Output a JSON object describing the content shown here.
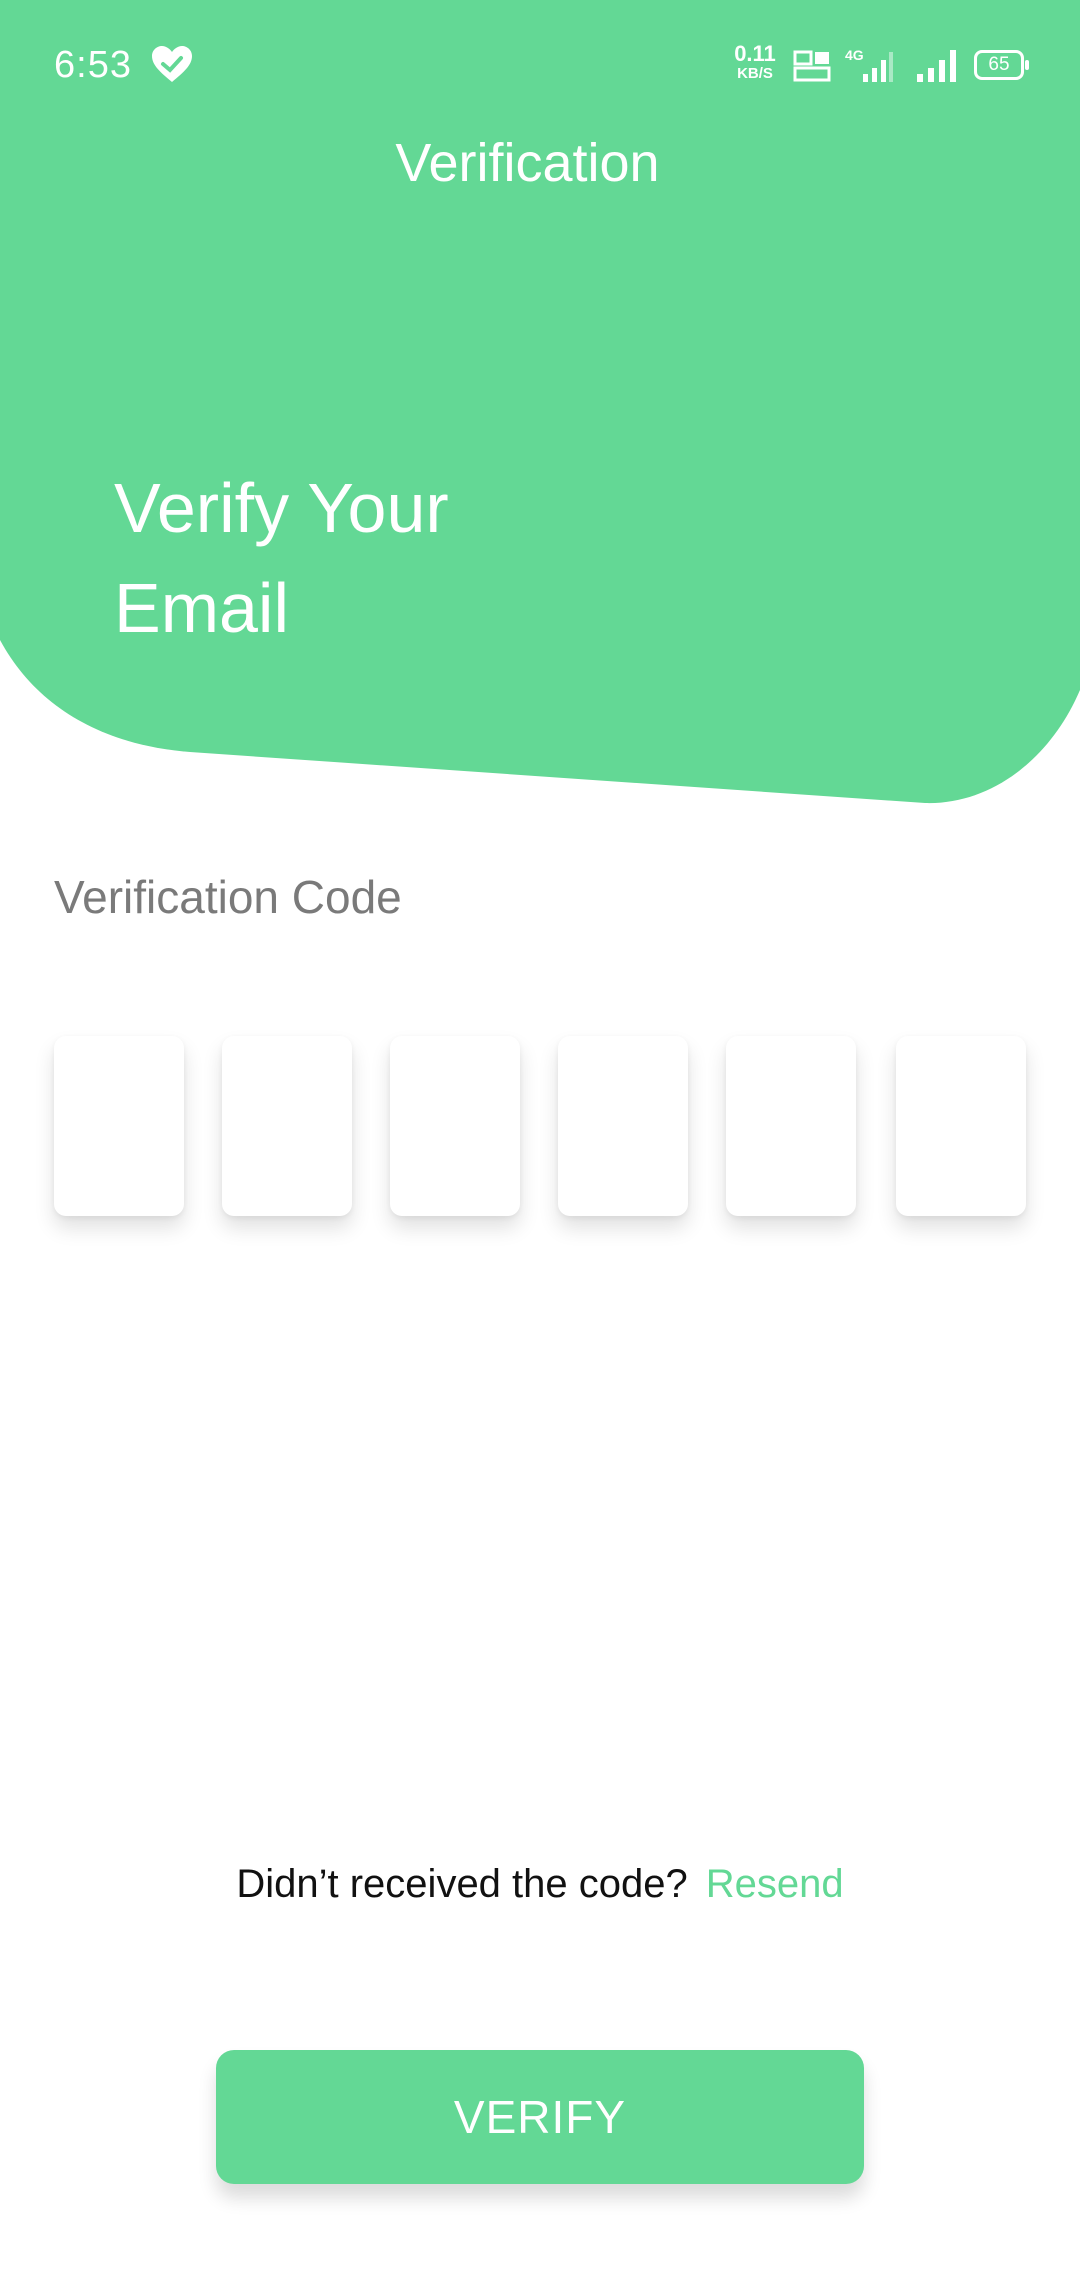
{
  "colors": {
    "accent": "#63d895",
    "background": "#ffffff",
    "label_gray": "#7a7a7a"
  },
  "status_bar": {
    "time": "6:53",
    "net_speed": "0.11",
    "net_unit": "KB/S",
    "network_type": "4G",
    "battery_level": "65"
  },
  "header": {
    "title": "Verification",
    "headline_line1": "Verify Your",
    "headline_line2": "Email"
  },
  "form": {
    "code_label": "Verification Code",
    "code_digits": [
      "",
      "",
      "",
      "",
      "",
      ""
    ]
  },
  "footer": {
    "prompt": "Didn’t received the code?",
    "resend_label": "Resend",
    "verify_label": "VERIFY"
  },
  "icons": {
    "health": "heart-check-icon",
    "volte": "volte-icon",
    "signal": "signal-icon",
    "battery": "battery-icon"
  }
}
